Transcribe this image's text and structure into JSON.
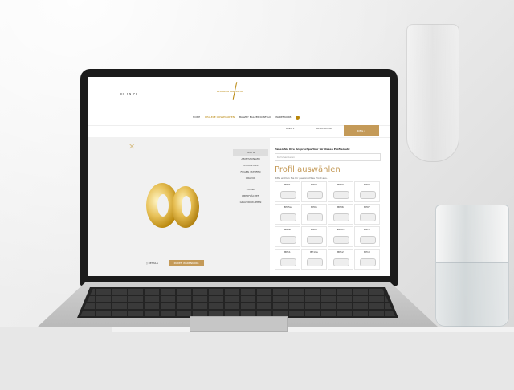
{
  "screen": {
    "languages": "DE  EN  FR",
    "logo": "LEXAMON BALZER AG",
    "nav": [
      "HOME",
      "REALEAE GOSSECARTEN",
      "BASZEY BALZER KONFIGU",
      "WARENKORB"
    ],
    "tabs": [
      "RING 1",
      "BEIDE RINGE",
      "RING 2"
    ],
    "menu": [
      "PROFIL",
      "ABMESSUNGEN",
      "EDELMETALL",
      "FUGEN / STUFEN",
      "GRAVUR",
      "STEINE",
      "OBERFLÄCHEN",
      "GRAVURGRUPPEN"
    ],
    "question": "Haben Sie Ihre Ansprechpartner für diesen Profilen eht",
    "input_placeholder": "Kommentieren",
    "profile_title": "Profil auswählen",
    "profile_subtitle": "Bitte wählen Sie Ihr gewünschtes Profil aus.",
    "profiles": [
      "BP01",
      "BP02",
      "BP03",
      "BP04",
      "BP05a",
      "BP05",
      "BP06",
      "BP07",
      "BP08",
      "BP09",
      "BP09a",
      "BP10",
      "BP11",
      "BP11a",
      "BP12",
      "BP13"
    ],
    "details_label": "DETAILS",
    "cart_label": "IN DEN WARENKORB"
  }
}
